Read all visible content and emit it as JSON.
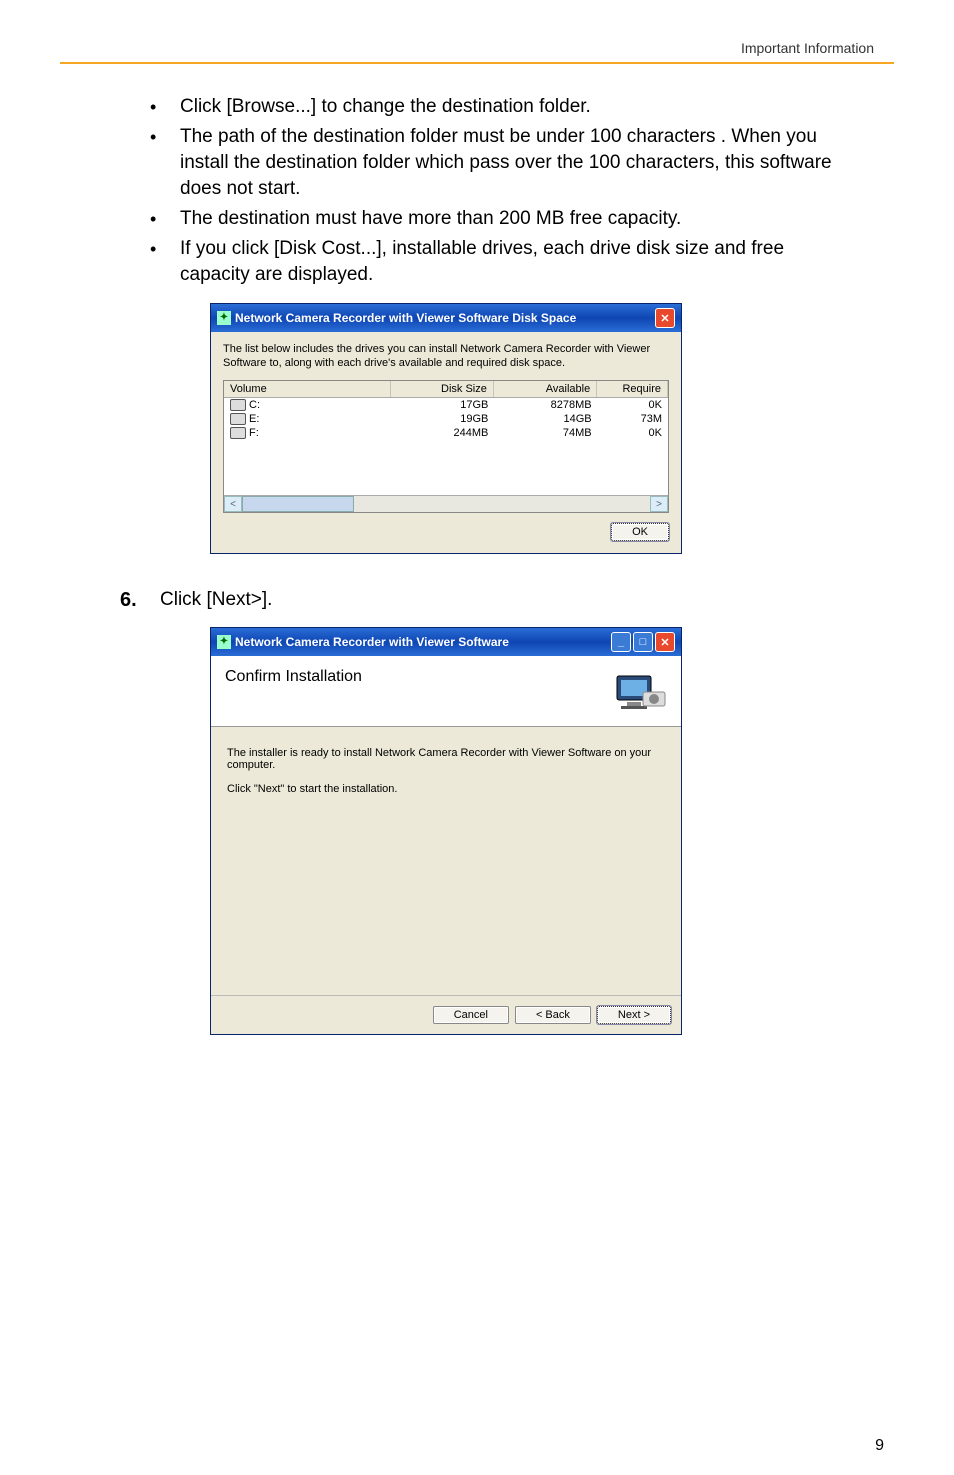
{
  "header": {
    "section": "Important Information"
  },
  "bullets": [
    "Click [Browse...] to change the destination folder.",
    "The path of the destination folder must be under 100 characters . When you install the destination folder which pass over the 100 characters, this software does not start.",
    "The destination must have more than 200 MB free capacity.",
    "If you click [Disk Cost...], installable drives, each drive disk size and free capacity are displayed."
  ],
  "dialog1": {
    "title": "Network Camera Recorder with Viewer Software Disk Space",
    "description": "The list below includes the drives you can install Network Camera Recorder with Viewer Software to, along with each drive's available and required disk space.",
    "columns": {
      "volume": "Volume",
      "disksize": "Disk Size",
      "available": "Available",
      "required": "Require"
    },
    "rows": [
      {
        "volume": "C:",
        "disksize": "17GB",
        "available": "8278MB",
        "required": "0K"
      },
      {
        "volume": "E:",
        "disksize": "19GB",
        "available": "14GB",
        "required": "73M"
      },
      {
        "volume": "F:",
        "disksize": "244MB",
        "available": "74MB",
        "required": "0K"
      }
    ],
    "ok": "OK"
  },
  "step6": {
    "num": "6.",
    "text": "Click [Next>]."
  },
  "dialog2": {
    "title": "Network Camera Recorder with Viewer Software",
    "heading": "Confirm Installation",
    "line1": "The installer is ready to install Network Camera Recorder with Viewer Software on your computer.",
    "line2": "Click \"Next\" to start the installation.",
    "buttons": {
      "cancel": "Cancel",
      "back": "< Back",
      "next": "Next >"
    }
  },
  "pageNumber": "9"
}
